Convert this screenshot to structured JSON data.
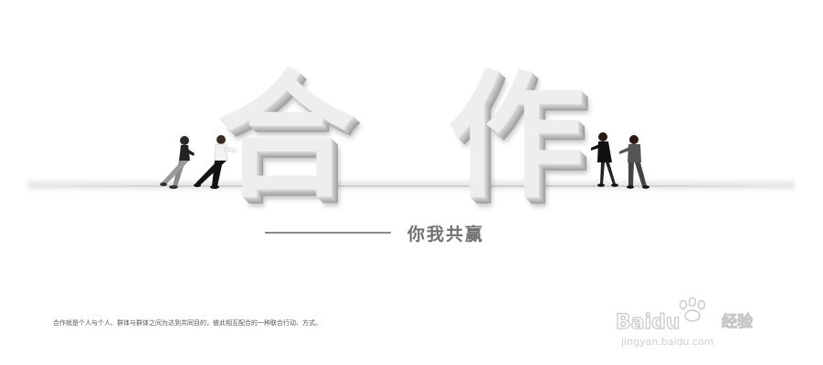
{
  "headline": {
    "char1": "合",
    "char2": "作"
  },
  "slogan": "你我共赢",
  "caption": "合作就是个人与个人、群体与群体之间为达到共同目的，彼此相互配合的一种联合行动、方式。",
  "watermark": {
    "brand": "Baidu",
    "suffix": "经验",
    "url": "jingyan.baidu.com"
  },
  "colors": {
    "block_face": "#eeeeee",
    "block_side": "#a9a9a9",
    "slogan": "#707070",
    "watermark": "#c8c8c8"
  }
}
